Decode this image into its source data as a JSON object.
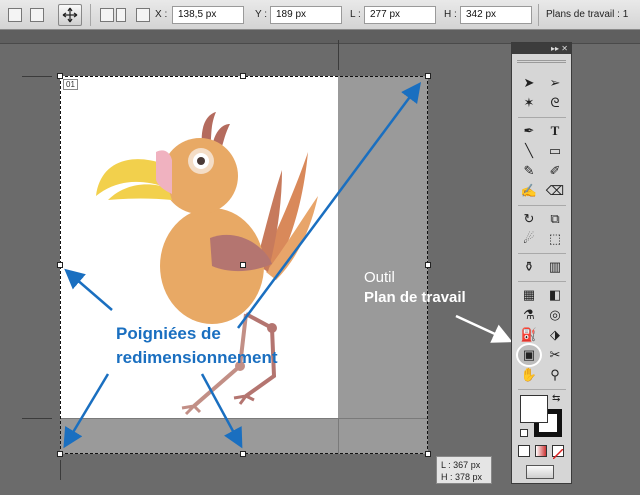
{
  "control_bar": {
    "x_label": "X :",
    "x_value": "138,5 px",
    "y_label": "Y :",
    "y_value": "189 px",
    "w_label": "L :",
    "w_value": "277 px",
    "h_label": "H :",
    "h_value": "342 px",
    "artboards_label": "Plans de travail : 1"
  },
  "artboard": {
    "number": "01"
  },
  "size_tooltip": {
    "width": "L : 367 px",
    "height": "H : 378 px"
  },
  "annotations": {
    "handles_line1": "Poigniées de",
    "handles_line2": "redimensionnement",
    "tool_line1": "Outil",
    "tool_line2": "Plan de travail"
  },
  "tools_panel": {
    "collapse_glyph": "▸▸ ✕"
  },
  "colors": {
    "annotation_blue": "#1a6fc0",
    "canvas": "#6b6b6b",
    "pasteboard": "#9a9a9a"
  }
}
